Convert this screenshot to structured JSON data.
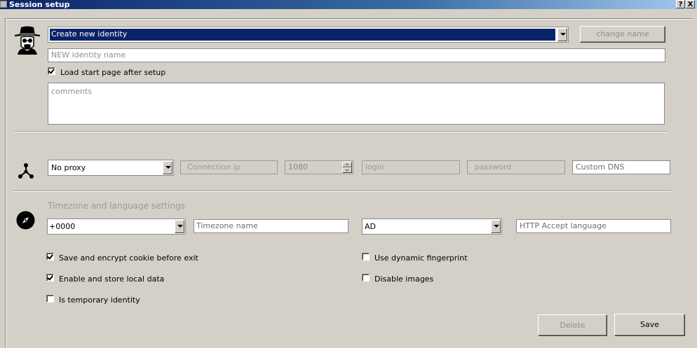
{
  "window": {
    "title": "Session setup",
    "help_label": "?",
    "close_label": "X"
  },
  "identity": {
    "icon": "heisenberg-avatar-icon",
    "selected": "Create new identity",
    "change_name_label": "change name",
    "name_placeholder": "NEW identity name",
    "load_start_page_label": "Load start page after setup",
    "load_start_page_checked": true,
    "comments_placeholder": "comments"
  },
  "proxy": {
    "icon": "network-nodes-icon",
    "type": "No proxy",
    "ip_placeholder": "Connection ip",
    "port": "1080",
    "login_placeholder": "login",
    "password_placeholder": "password",
    "dns_placeholder": "Custom DNS"
  },
  "locale": {
    "icon": "compass-icon",
    "section_title": "Timezone and language settings",
    "offset": "+0000",
    "timezone_placeholder": "Timezone name",
    "language": "AD",
    "accept_language_placeholder": "HTTP Accept language"
  },
  "options": {
    "save_cookie": {
      "label": "Save and encrypt cookie before exit",
      "checked": true
    },
    "local_data": {
      "label": "Enable and store local data",
      "checked": true
    },
    "temporary": {
      "label": "Is temporary identity",
      "checked": false
    },
    "dynamic_fp": {
      "label": "Use dynamic fingerprint",
      "checked": false
    },
    "disable_images": {
      "label": "Disable images",
      "checked": false
    }
  },
  "footer": {
    "delete_label": "Delete",
    "save_label": "Save"
  }
}
